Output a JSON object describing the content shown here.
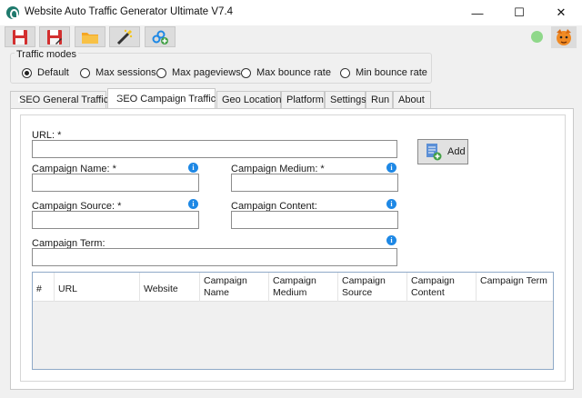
{
  "window": {
    "title": "Website Auto Traffic Generator Ultimate V7.4",
    "controls": [
      "—",
      "☐",
      "✕"
    ]
  },
  "toolbar": {
    "buttons": [
      "save-icon",
      "save-as-icon",
      "open-folder-icon",
      "magic-wand-icon",
      "add-link-icon"
    ],
    "status_color": "#8fd88a"
  },
  "traffic_modes": {
    "legend": "Traffic modes",
    "options": [
      "Default",
      "Max sessions",
      "Max pageviews",
      "Max bounce rate",
      "Min bounce rate"
    ],
    "selected": "Default"
  },
  "tabs": [
    "SEO General Traffic",
    "SEO Campaign Traffic",
    "Geo Location",
    "Platform",
    "Settings",
    "Run",
    "About"
  ],
  "active_tab": "SEO Campaign Traffic",
  "form": {
    "url_label": "URL: *",
    "url_value": "",
    "campaign_name_label": "Campaign Name: *",
    "campaign_medium_label": "Campaign Medium: *",
    "campaign_source_label": "Campaign Source: *",
    "campaign_content_label": "Campaign Content:",
    "campaign_term_label": "Campaign Term:",
    "info_glyph": "i",
    "add_label": "Add"
  },
  "table": {
    "columns": [
      "#",
      "URL",
      "Website",
      "Campaign Name",
      "Campaign Medium",
      "Campaign Source",
      "Campaign Content",
      "Campaign Term"
    ],
    "rows": []
  },
  "colors": {
    "accent_blue": "#1e88e5",
    "youtube_red": "#e02020",
    "campaign_blue": "#1c2fd1"
  }
}
